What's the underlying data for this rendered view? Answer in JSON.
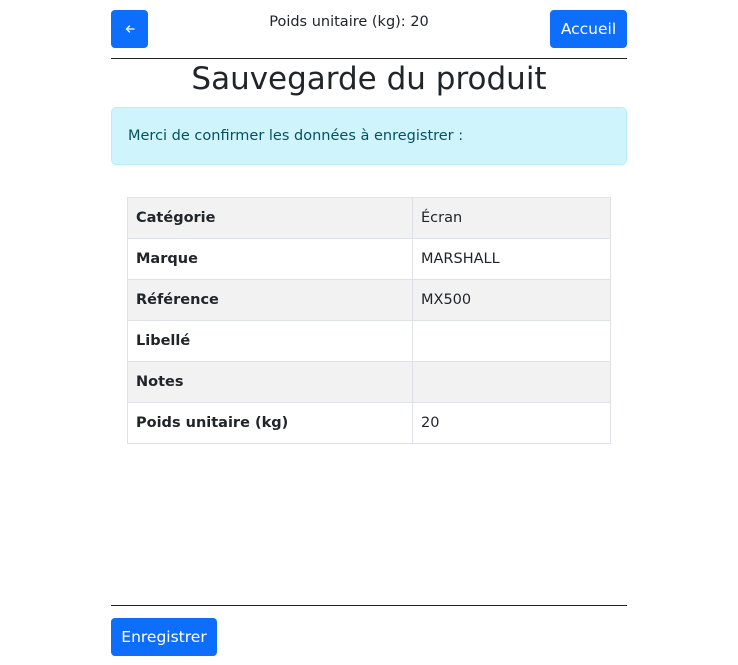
{
  "header": {
    "back_icon": "arrow-left-icon",
    "info_label": "Poids unitaire (kg):",
    "info_value": "20",
    "home_label": "Accueil"
  },
  "page": {
    "title": "Sauvegarde du produit",
    "alert": "Merci de confirmer les données à enregistrer :"
  },
  "table": {
    "rows": [
      {
        "label": "Catégorie",
        "value": "Écran"
      },
      {
        "label": "Marque",
        "value": "MARSHALL"
      },
      {
        "label": "Référence",
        "value": "MX500"
      },
      {
        "label": "Libellé",
        "value": ""
      },
      {
        "label": "Notes",
        "value": ""
      },
      {
        "label": "Poids unitaire (kg)",
        "value": "20"
      }
    ]
  },
  "footer": {
    "save_label": "Enregistrer"
  },
  "colors": {
    "primary": "#0d6efd",
    "alert_bg": "#cff4fc",
    "alert_text": "#055160",
    "stripe": "#f2f2f2"
  }
}
